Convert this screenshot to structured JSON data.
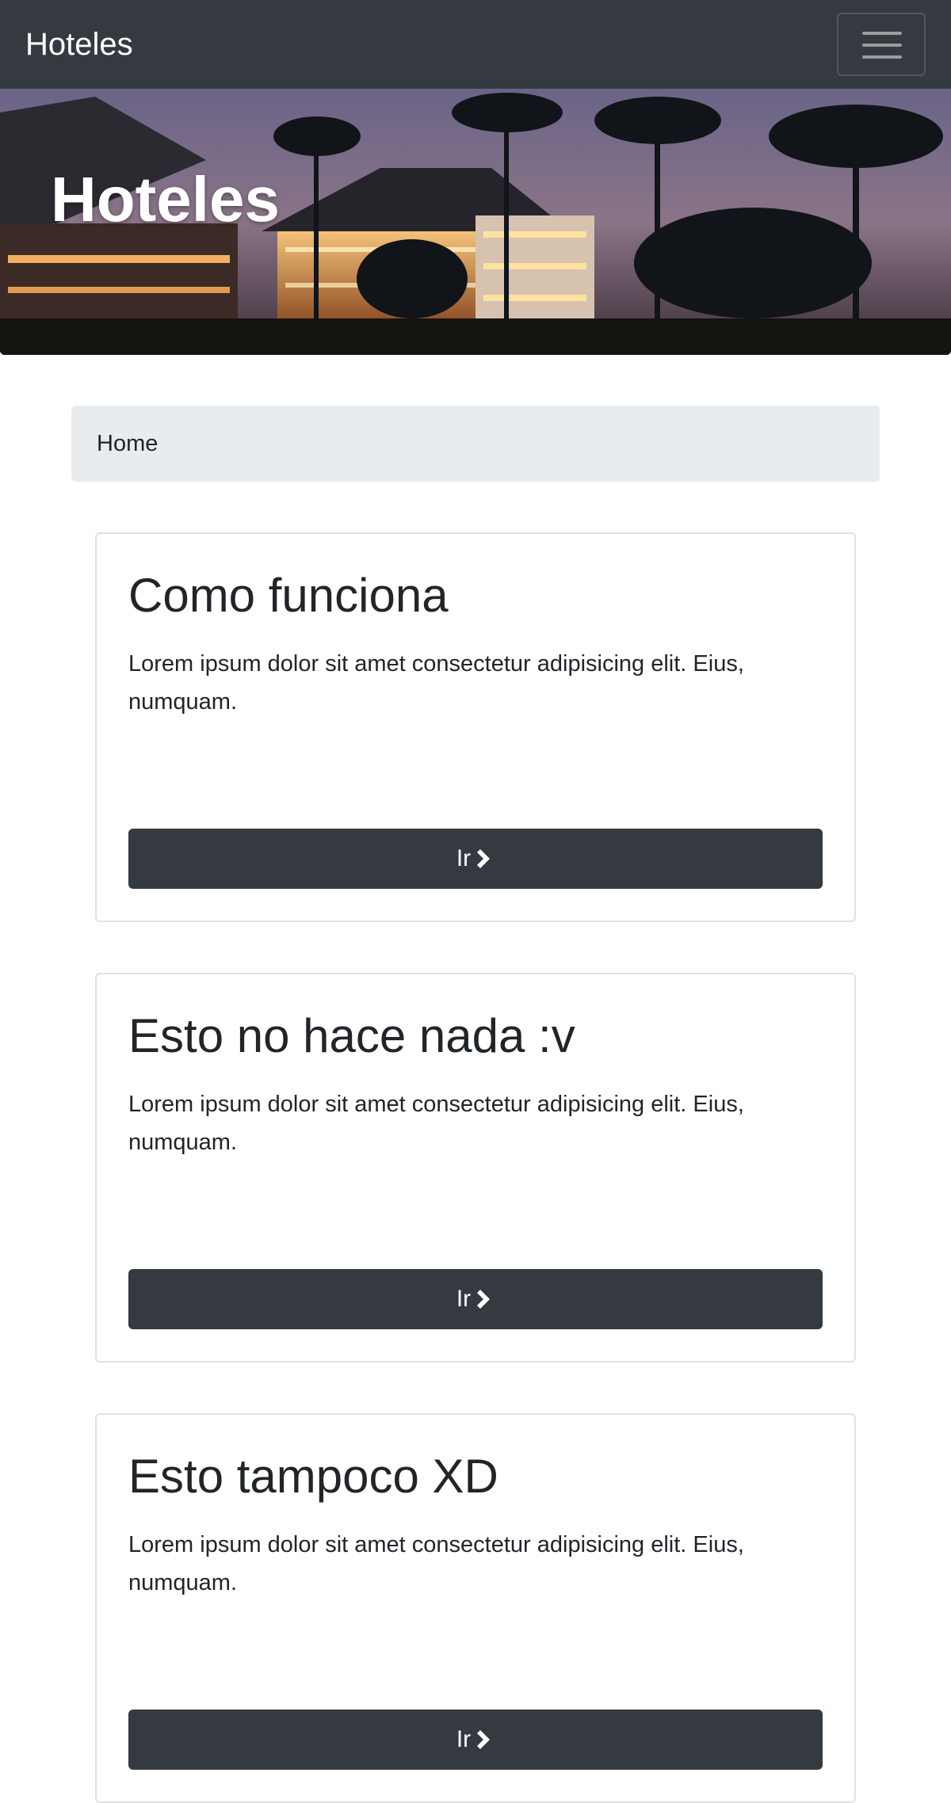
{
  "navbar": {
    "brand": "Hoteles",
    "toggler_icon": "hamburger-menu-icon"
  },
  "hero": {
    "title": "Hoteles"
  },
  "breadcrumb": {
    "items": [
      "Home"
    ]
  },
  "cards": [
    {
      "title": "Como funciona",
      "text": "Lorem ipsum dolor sit amet consectetur adipisicing elit. Eius, numquam.",
      "button_label": "Ir",
      "button_icon": "chevron-right-icon"
    },
    {
      "title": "Esto no hace nada :v",
      "text": "Lorem ipsum dolor sit amet consectetur adipisicing elit. Eius, numquam.",
      "button_label": "Ir",
      "button_icon": "chevron-right-icon"
    },
    {
      "title": "Esto tampoco XD",
      "text": "Lorem ipsum dolor sit amet consectetur adipisicing elit. Eius, numquam.",
      "button_label": "Ir",
      "button_icon": "chevron-right-icon"
    }
  ],
  "colors": {
    "navbar_bg": "#343a40",
    "button_bg": "#343a40",
    "breadcrumb_bg": "#e9ecef",
    "text": "#212529"
  }
}
